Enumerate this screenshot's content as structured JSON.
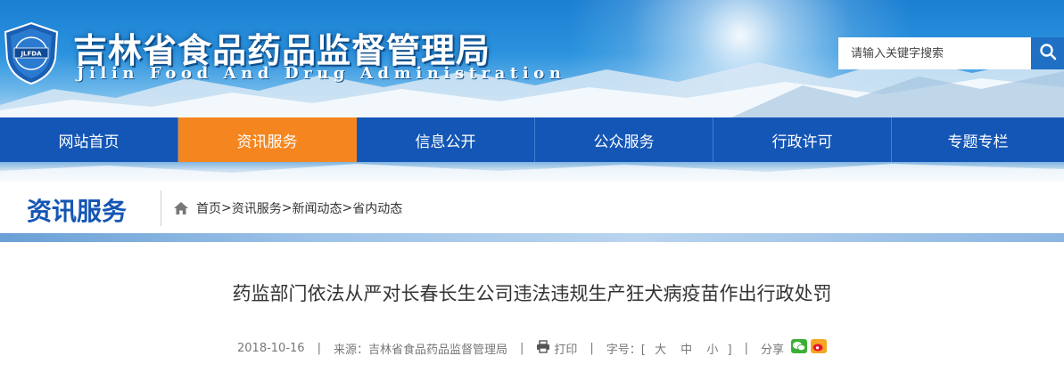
{
  "header": {
    "title": "吉林省食品药品监督管理局",
    "subtitle": "Jilin Food And Drug Administration",
    "logo_text": "JLFDA",
    "search_placeholder": "请输入关键字搜索"
  },
  "nav": {
    "items": [
      {
        "label": "网站首页"
      },
      {
        "label": "资讯服务"
      },
      {
        "label": "信息公开"
      },
      {
        "label": "公众服务"
      },
      {
        "label": "行政许可"
      },
      {
        "label": "专题专栏"
      }
    ],
    "active_index": 1
  },
  "section": {
    "title": "资讯服务",
    "breadcrumb": [
      "首页",
      "资讯服务",
      "新闻动态",
      "省内动态"
    ],
    "separator": ">"
  },
  "article": {
    "title": "药监部门依法从严对长春长生公司违法违规生产狂犬病疫苗作出行政处罚",
    "date": "2018-10-16",
    "source_label": "来源：",
    "source": "吉林省食品药品监督管理局",
    "print_label": "打印",
    "font_size_label": "字号：[",
    "font_sizes": [
      "大",
      "中",
      "小"
    ],
    "font_size_close": "]",
    "share_label": "分享",
    "divider": "|"
  },
  "colors": {
    "nav_bg": "#1456b6",
    "nav_active": "#f5861f",
    "section_title": "#1556b3",
    "wechat": "#3cb034",
    "weibo": "#e6162d"
  },
  "icons": {
    "search": "search-icon",
    "home": "home-icon",
    "print": "printer-icon",
    "wechat": "wechat-icon",
    "weibo": "weibo-icon"
  }
}
